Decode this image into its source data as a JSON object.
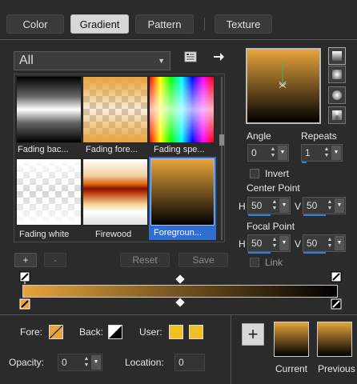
{
  "tabs": [
    {
      "label": "Color"
    },
    {
      "label": "Gradient"
    },
    {
      "label": "Pattern"
    },
    {
      "label": "Texture"
    }
  ],
  "category_select": {
    "value": "All"
  },
  "gradients": [
    {
      "label": "Fading bac..."
    },
    {
      "label": "Fading fore..."
    },
    {
      "label": "Fading spe..."
    },
    {
      "label": "Fading white"
    },
    {
      "label": "Firewood"
    },
    {
      "label": "Foregroun..."
    }
  ],
  "list_buttons": {
    "add": "+",
    "remove": "-",
    "reset": "Reset",
    "save": "Save"
  },
  "angle": {
    "label": "Angle",
    "value": "0"
  },
  "repeats": {
    "label": "Repeats",
    "value": "1"
  },
  "invert": {
    "label": "Invert"
  },
  "center_point": {
    "label": "Center Point",
    "h_label": "H",
    "h_value": "50",
    "v_label": "V",
    "v_value": "50"
  },
  "focal_point": {
    "label": "Focal Point",
    "h_label": "H",
    "h_value": "50",
    "v_label": "V",
    "v_value": "50"
  },
  "link": {
    "label": "Link"
  },
  "fore": {
    "label": "Fore:"
  },
  "back": {
    "label": "Back:"
  },
  "user": {
    "label": "User:"
  },
  "opacity": {
    "label": "Opacity:",
    "value": "0"
  },
  "location": {
    "label": "Location:",
    "value": "0"
  },
  "add_button": {
    "label": "+"
  },
  "current": {
    "label": "Current"
  },
  "previous": {
    "label": "Previous"
  },
  "colors": {
    "accent": "#2f6fd1",
    "gold": "#e8a43c",
    "black": "#000000",
    "user_yellow": "#f0c020"
  }
}
